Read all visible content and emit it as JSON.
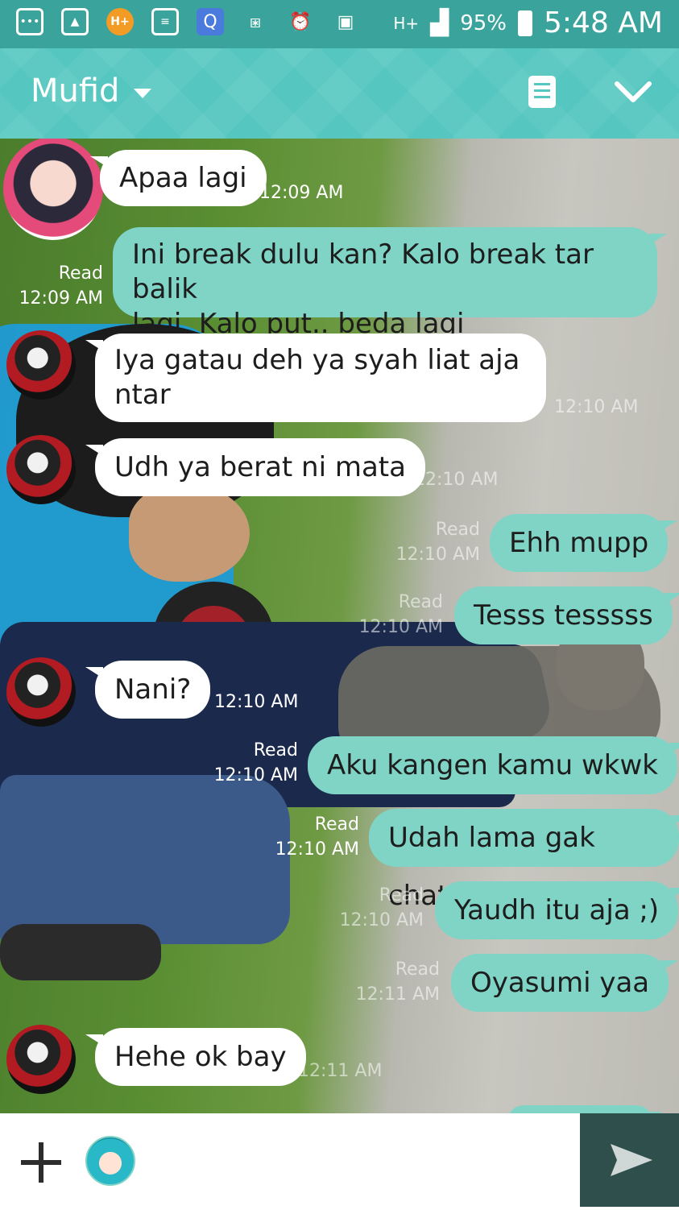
{
  "status_bar": {
    "battery": "95%",
    "time": "5:48 AM",
    "network": "H+",
    "icons": [
      "chat-bubble-icon",
      "gallery-icon",
      "hplus-app-icon",
      "bbm-icon",
      "search-app-icon",
      "vibrate-icon",
      "alarm-icon",
      "sim-icon",
      "network-icon",
      "signal-icon",
      "battery-icon"
    ]
  },
  "header": {
    "title": "Mufid",
    "icons": [
      "dropdown-caret-icon",
      "notes-icon",
      "collapse-check-icon"
    ]
  },
  "messages": [
    {
      "side": "in",
      "text": "Apaa lagi",
      "time": "12:09 AM",
      "avatar": "anime-girl-avatar"
    },
    {
      "side": "out",
      "text_lines": [
        "Ini break dulu kan? Kalo break tar balik",
        "lagi. Kalo put.. beda lagi"
      ],
      "read": "Read",
      "time": "12:09 AM"
    },
    {
      "side": "in",
      "text_lines": [
        "Iya gatau deh ya syah liat aja",
        "ntar"
      ],
      "time": "12:10 AM",
      "avatar": "ghoul-avatar"
    },
    {
      "side": "in",
      "text": "Udh ya berat ni mata",
      "time": "12:10 AM",
      "avatar": "ghoul-avatar"
    },
    {
      "side": "out",
      "text": "Ehh mupp",
      "read": "Read",
      "time": "12:10 AM"
    },
    {
      "side": "out",
      "text": "Tesss tesssss",
      "read": "Read",
      "time": "12:10 AM"
    },
    {
      "side": "in",
      "text": "Nani?",
      "time": "12:10 AM",
      "avatar": "ghoul-avatar"
    },
    {
      "side": "out",
      "text": "Aku kangen kamu wkwk",
      "read": "Read",
      "time": "12:10 AM"
    },
    {
      "side": "out",
      "text": "Udah lama gak chat",
      "read": "Read",
      "time": "12:10 AM"
    },
    {
      "side": "out",
      "text": "Yaudh itu aja ;)",
      "read": "Read",
      "time": "12:10 AM"
    },
    {
      "side": "out",
      "text": "Oyasumi yaa",
      "read": "Read",
      "time": "12:11 AM"
    },
    {
      "side": "in",
      "text": "Hehe ok bay",
      "time": "12:11 AM",
      "avatar": "ghoul-avatar"
    }
  ],
  "input_bar": {
    "icons": [
      "add-icon",
      "sticker-icon",
      "send-icon"
    ]
  },
  "colors": {
    "status_bar": "#3aa39b",
    "header": "#55c6c0",
    "outgoing_bubble": "#7fd4c6",
    "incoming_bubble": "#ffffff",
    "send_button": "#2f4f4c"
  }
}
